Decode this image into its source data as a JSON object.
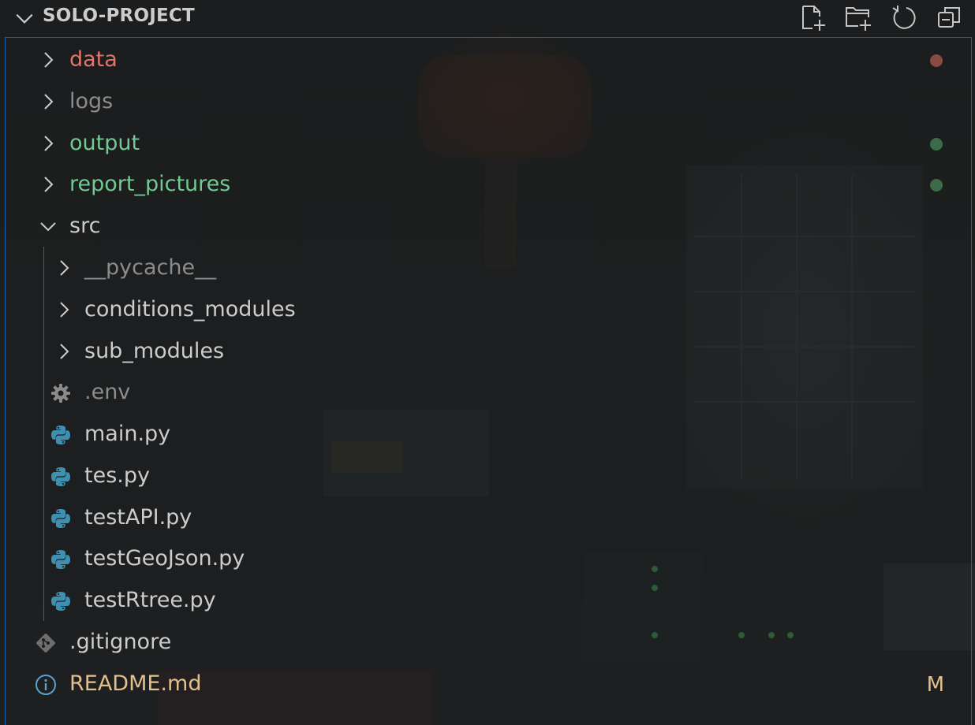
{
  "explorer": {
    "title": "SOLO-PROJECT",
    "header_icons": [
      "new-file-icon",
      "new-folder-icon",
      "refresh-icon",
      "collapse-all-icon"
    ]
  },
  "colors": {
    "untracked_red": "#e2756a",
    "added_green": "#73c991",
    "ignored_gray": "#8c8c8c",
    "default_text": "#cccccc",
    "modified_orange": "#e2c08d",
    "dot_red": "#8a4a44",
    "dot_green": "#3b6b48",
    "focus_border": "#0e64b0",
    "python_blue": "#3e8fb0"
  },
  "tree": {
    "items": [
      {
        "label": "data",
        "type": "folder",
        "expanded": false,
        "depth": 0,
        "color": "#e2756a",
        "decoration": "dot",
        "decoration_color": "#8a4a44"
      },
      {
        "label": "logs",
        "type": "folder",
        "expanded": false,
        "depth": 0,
        "color": "#8c8c8c"
      },
      {
        "label": "output",
        "type": "folder",
        "expanded": false,
        "depth": 0,
        "color": "#73c991",
        "decoration": "dot",
        "decoration_color": "#3b6b48"
      },
      {
        "label": "report_pictures",
        "type": "folder",
        "expanded": false,
        "depth": 0,
        "color": "#73c991",
        "decoration": "dot",
        "decoration_color": "#3b6b48"
      },
      {
        "label": "src",
        "type": "folder",
        "expanded": true,
        "depth": 0,
        "color": "#cccccc"
      },
      {
        "label": "__pycache__",
        "type": "folder",
        "expanded": false,
        "depth": 1,
        "color": "#8c8c8c"
      },
      {
        "label": "conditions_modules",
        "type": "folder",
        "expanded": false,
        "depth": 1,
        "color": "#cccccc"
      },
      {
        "label": "sub_modules",
        "type": "folder",
        "expanded": false,
        "depth": 1,
        "color": "#cccccc"
      },
      {
        "label": ".env",
        "type": "file",
        "icon": "gear-icon",
        "depth": 1,
        "color": "#8c8c8c"
      },
      {
        "label": "main.py",
        "type": "file",
        "icon": "python-icon",
        "depth": 1,
        "color": "#cccccc"
      },
      {
        "label": "tes.py",
        "type": "file",
        "icon": "python-icon",
        "depth": 1,
        "color": "#cccccc"
      },
      {
        "label": "testAPI.py",
        "type": "file",
        "icon": "python-icon",
        "depth": 1,
        "color": "#cccccc"
      },
      {
        "label": "testGeoJson.py",
        "type": "file",
        "icon": "python-icon",
        "depth": 1,
        "color": "#cccccc"
      },
      {
        "label": "testRtree.py",
        "type": "file",
        "icon": "python-icon",
        "depth": 1,
        "color": "#cccccc"
      },
      {
        "label": ".gitignore",
        "type": "file",
        "icon": "git-icon",
        "depth": 0,
        "color": "#cccccc"
      },
      {
        "label": "README.md",
        "type": "file",
        "icon": "info-icon",
        "depth": 0,
        "color": "#e2c08d",
        "decoration": "badge",
        "badge": "M",
        "decoration_color": "#e2c08d"
      }
    ]
  }
}
